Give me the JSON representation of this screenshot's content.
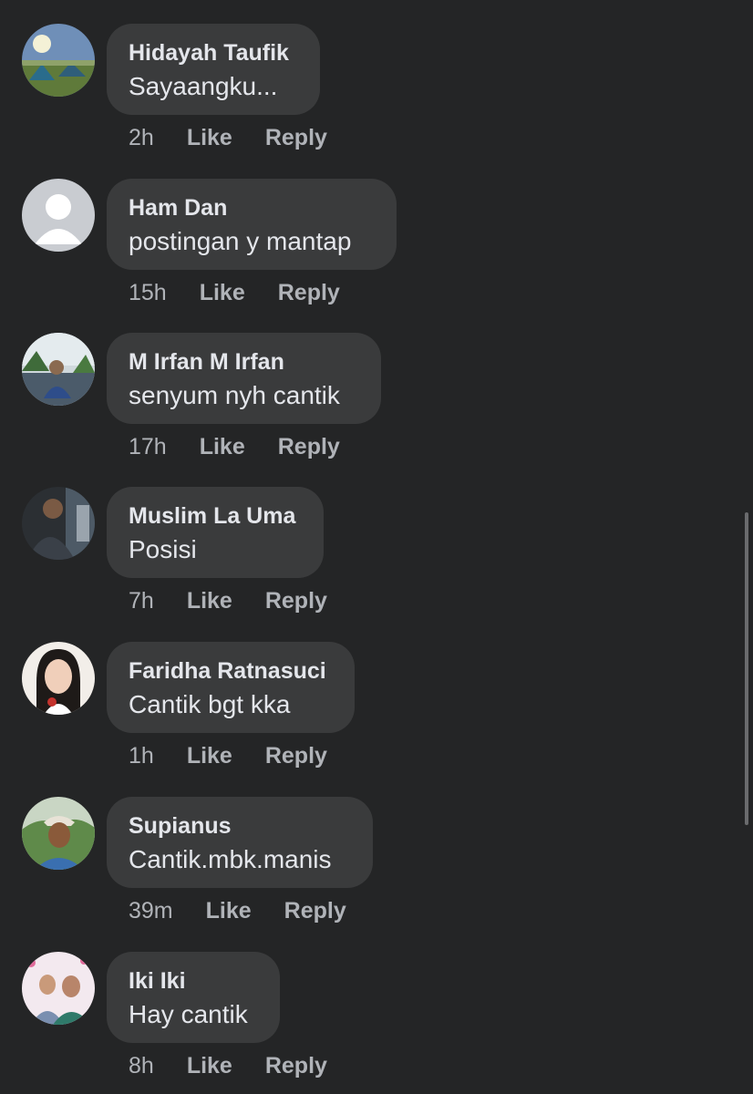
{
  "comments": [
    {
      "author": "Hidayah Taufik",
      "text": "Sayaangku...",
      "time": "2h",
      "like": "Like",
      "reply": "Reply"
    },
    {
      "author": "Ham Dan",
      "text": "postingan y mantap",
      "time": "15h",
      "like": "Like",
      "reply": "Reply"
    },
    {
      "author": "M Irfan M Irfan",
      "text": "senyum nyh cantik",
      "time": "17h",
      "like": "Like",
      "reply": "Reply"
    },
    {
      "author": "Muslim La Uma",
      "text": "Posisi",
      "time": "7h",
      "like": "Like",
      "reply": "Reply"
    },
    {
      "author": "Faridha Ratnasuci",
      "text": "Cantik bgt kka",
      "time": "1h",
      "like": "Like",
      "reply": "Reply"
    },
    {
      "author": "Supianus",
      "text": "Cantik.mbk.manis",
      "time": "39m",
      "like": "Like",
      "reply": "Reply"
    },
    {
      "author": "Iki Iki",
      "text": "Hay cantik",
      "time": "8h",
      "like": "Like",
      "reply": "Reply"
    }
  ],
  "colors": {
    "background": "#242526",
    "bubble": "#3a3b3c",
    "primary_text": "#e4e6eb",
    "secondary_text": "#b0b3b8"
  }
}
